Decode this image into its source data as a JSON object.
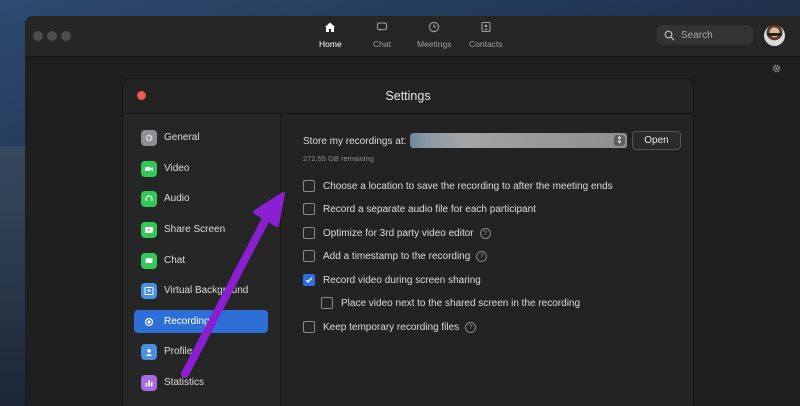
{
  "nav": {
    "home": "Home",
    "chat": "Chat",
    "meetings": "Meetings",
    "contacts": "Contacts"
  },
  "search": {
    "placeholder": "Search"
  },
  "settings": {
    "title": "Settings",
    "sidebar": [
      {
        "label": "General",
        "icon": "gear-icon",
        "color": "#8e8e93"
      },
      {
        "label": "Video",
        "icon": "video-camera-icon",
        "color": "#34c759"
      },
      {
        "label": "Audio",
        "icon": "headphones-icon",
        "color": "#34c759"
      },
      {
        "label": "Share Screen",
        "icon": "share-screen-icon",
        "color": "#34c759"
      },
      {
        "label": "Chat",
        "icon": "chat-bubble-icon",
        "color": "#34c759"
      },
      {
        "label": "Virtual Background",
        "icon": "person-background-icon",
        "color": "#4a90e2"
      },
      {
        "label": "Recording",
        "icon": "record-icon",
        "color": "#2d6fd6"
      },
      {
        "label": "Profile",
        "icon": "profile-icon",
        "color": "#4a90e2"
      },
      {
        "label": "Statistics",
        "icon": "statistics-icon",
        "color": "#a56be0"
      }
    ],
    "active_index": 6,
    "recording": {
      "store_label": "Store my recordings at:",
      "open_button": "Open",
      "remaining": "272.55 GB remaining",
      "options": [
        {
          "label": "Choose a location to save the recording to after the meeting ends",
          "checked": false,
          "help": false
        },
        {
          "label": "Record a separate audio file for each participant",
          "checked": false,
          "help": false
        },
        {
          "label": "Optimize for 3rd party video editor",
          "checked": false,
          "help": true
        },
        {
          "label": "Add a timestamp to the recording",
          "checked": false,
          "help": true
        },
        {
          "label": "Record video during screen sharing",
          "checked": true,
          "help": false
        },
        {
          "label": "Place video next to the shared screen in the recording",
          "checked": false,
          "help": false
        },
        {
          "label": "Keep temporary recording files",
          "checked": false,
          "help": true
        }
      ]
    }
  },
  "colors": {
    "accent": "#2d6fd6",
    "annotation_arrow": "#8a1fd1"
  }
}
